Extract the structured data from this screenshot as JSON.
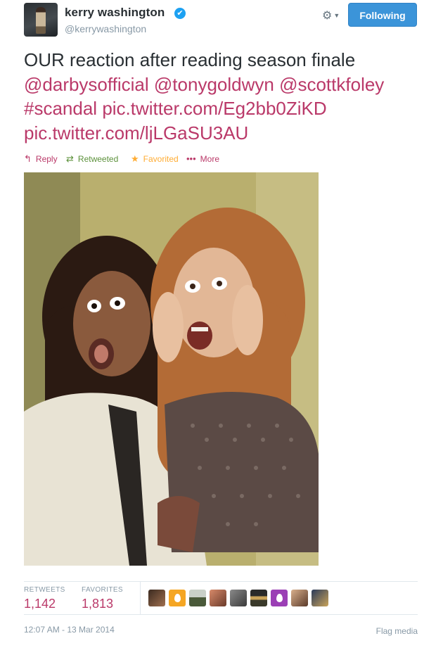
{
  "author": {
    "fullname": "kerry washington",
    "username": "@kerrywashington",
    "verified_mark": "✔"
  },
  "header": {
    "follow_label": "Following",
    "gear_icon": "⚙",
    "chevron_icon": "▼"
  },
  "tweet": {
    "text_plain": "OUR reaction after reading season finale",
    "mentions": [
      "@darbysofficial",
      "@tonygoldwyn",
      "@scottkfoley"
    ],
    "hashtag": "#scandal",
    "links": [
      "pic.twitter.com/Eg2bb0ZiKD",
      "pic.twitter.com/ljLGaSU3AU"
    ]
  },
  "actions": {
    "reply": {
      "label": "Reply",
      "icon": "↰"
    },
    "retweet": {
      "label": "Retweeted",
      "icon": "⇄"
    },
    "favorite": {
      "label": "Favorited",
      "icon": "★"
    },
    "more": {
      "label": "More",
      "icon": "•••"
    }
  },
  "stats": {
    "retweets_label": "RETWEETS",
    "retweets_value": "1,142",
    "favorites_label": "FAVORITES",
    "favorites_value": "1,813"
  },
  "footer": {
    "timestamp": "12:07 AM - 13 Mar 2014",
    "flag": "Flag media"
  },
  "colors": {
    "link": "#ba3969",
    "retweet": "#5c913b",
    "favorite": "#ffac33",
    "follow_button": "#3b94d9"
  }
}
